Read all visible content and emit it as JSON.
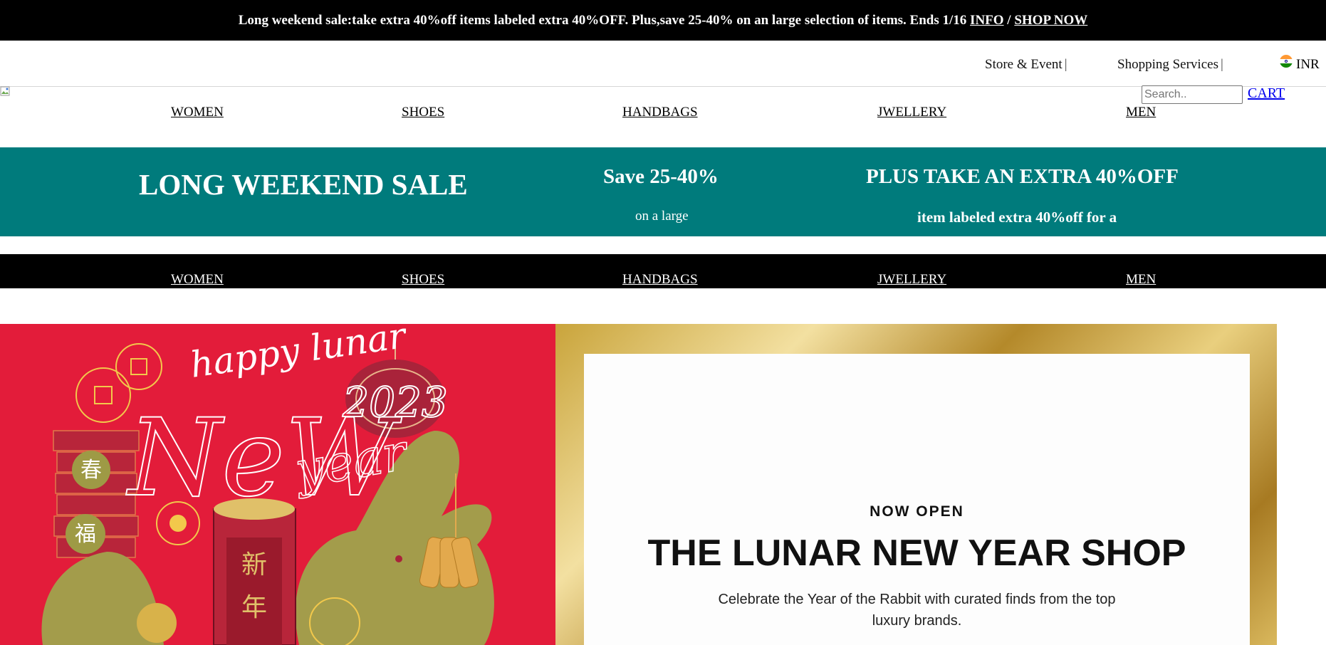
{
  "promo": {
    "text": "Long weekend sale:take extra 40%off items labeled extra 40%OFF. Plus,save 25-40% on an large selection of items. Ends 1/16",
    "info_link": "INFO",
    "separator": "/",
    "shop_link": "SHOP NOW"
  },
  "utility": {
    "store_event": "Store & Event",
    "shopping_services": "Shopping Services",
    "separator": "|",
    "currency": "INR"
  },
  "header": {
    "search_placeholder": "Search..",
    "cart_label": "CART"
  },
  "nav": {
    "items": [
      "WOMEN",
      "SHOES",
      "HANDBAGS",
      "JWELLERY",
      "MEN"
    ]
  },
  "sale_banner": {
    "title": "LONG WEEKEND SALE",
    "save": "Save 25-40%",
    "save_sub": "on a large",
    "extra": "PLUS TAKE AN EXTRA 40%OFF",
    "extra_sub": "item labeled extra 40%off for a"
  },
  "hero": {
    "art_text": "happy lunar NeW year",
    "art_year": "2023",
    "eyebrow": "NOW OPEN",
    "title": "THE LUNAR NEW YEAR SHOP",
    "description": "Celebrate the Year of the Rabbit with curated finds from the top luxury brands."
  }
}
